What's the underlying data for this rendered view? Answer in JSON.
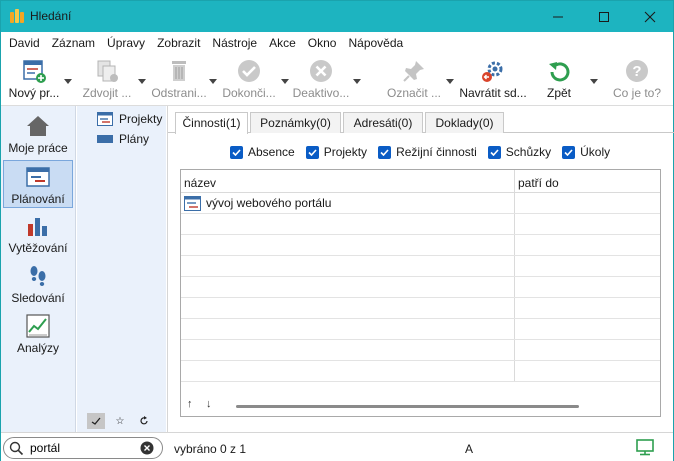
{
  "window": {
    "title": "Hledání"
  },
  "menu": [
    "David",
    "Záznam",
    "Úpravy",
    "Zobrazit",
    "Nástroje",
    "Akce",
    "Okno",
    "Nápověda"
  ],
  "toolbar": {
    "new_label": "Nový pr...",
    "duplicate_label": "Zdvojit ...",
    "remove_label": "Odstrani...",
    "complete_label": "Dokonči...",
    "deactivate_label": "Deaktivo...",
    "mark_label": "Označit ...",
    "return_label": "Navrátit sd...",
    "back_label": "Zpět",
    "help_label": "Co je to?"
  },
  "nav": {
    "items": [
      {
        "label": "Moje práce",
        "icon": "home-icon"
      },
      {
        "label": "Plánování",
        "icon": "planning-icon"
      },
      {
        "label": "Vytěžování",
        "icon": "bar-chart-icon"
      },
      {
        "label": "Sledování",
        "icon": "footprints-icon"
      },
      {
        "label": "Analýzy",
        "icon": "trend-chart-icon"
      }
    ]
  },
  "tree": {
    "items": [
      {
        "label": "Projekty",
        "icon": "projects-icon"
      },
      {
        "label": "Plány",
        "icon": "plans-icon"
      }
    ]
  },
  "tabs": [
    "Činnosti(1)",
    "Poznámky(0)",
    "Adresáti(0)",
    "Doklady(0)"
  ],
  "filters": [
    "Absence",
    "Projekty",
    "Režijní činnosti",
    "Schůzky",
    "Úkoly"
  ],
  "grid": {
    "columns": [
      "název",
      "patří do"
    ],
    "rows": [
      {
        "name": "vývoj webového portálu",
        "parent": ""
      }
    ]
  },
  "status": {
    "search_value": "portál",
    "selection": "vybráno 0 z 1",
    "mode": "A"
  },
  "colors": {
    "titlebar": "#1db4c0",
    "accent": "#0a5cc5",
    "nav_bg": "#eaf1fb",
    "nav_active": "#c9dcf3"
  }
}
